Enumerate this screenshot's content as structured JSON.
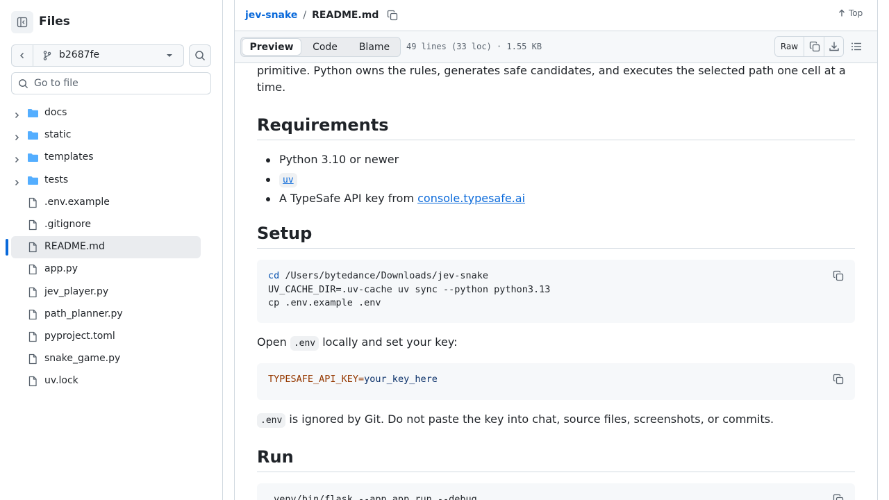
{
  "sidebar": {
    "title": "Files",
    "branch": "b2687fe",
    "goto_placeholder": "Go to file",
    "tree": [
      {
        "label": "docs",
        "type": "folder"
      },
      {
        "label": "static",
        "type": "folder"
      },
      {
        "label": "templates",
        "type": "folder"
      },
      {
        "label": "tests",
        "type": "folder"
      },
      {
        "label": ".env.example",
        "type": "file"
      },
      {
        "label": ".gitignore",
        "type": "file"
      },
      {
        "label": "README.md",
        "type": "file",
        "selected": true
      },
      {
        "label": "app.py",
        "type": "file"
      },
      {
        "label": "jev_player.py",
        "type": "file"
      },
      {
        "label": "path_planner.py",
        "type": "file"
      },
      {
        "label": "pyproject.toml",
        "type": "file"
      },
      {
        "label": "snake_game.py",
        "type": "file"
      },
      {
        "label": "uv.lock",
        "type": "file"
      }
    ]
  },
  "header": {
    "repo": "jev-snake",
    "separator": "/",
    "file": "README.md",
    "top_label": "Top"
  },
  "file_bar": {
    "tabs": [
      "Preview",
      "Code",
      "Blame"
    ],
    "active_tab": "Preview",
    "meta": "49 lines (33 loc) · 1.55 KB",
    "raw_label": "Raw"
  },
  "readme": {
    "intro": "primitive. Python owns the rules, generates safe candidates, and executes the selected path one cell at a time.",
    "requirements_heading": "Requirements",
    "req_python": "Python 3.10 or newer",
    "req_uv": "uv",
    "req_api_prefix": "A TypeSafe API key from ",
    "req_api_link": "console.typesafe.ai",
    "setup_heading": "Setup",
    "setup_code": {
      "line1_cmd": "cd",
      "line1_arg": " /Users/bytedance/Downloads/jev-snake",
      "line2": "UV_CACHE_DIR=.uv-cache uv sync --python python3.13",
      "line3": "cp .env.example .env"
    },
    "open_prefix": "Open ",
    "open_code": ".env",
    "open_suffix": " locally and set your key:",
    "env_code": {
      "var": "TYPESAFE_API_KEY=",
      "value": "your_key_here"
    },
    "ignored_code": ".env",
    "ignored_text": " is ignored by Git. Do not paste the key into chat, source files, screenshots, or commits.",
    "run_heading": "Run",
    "run_code": ".venv/bin/flask --app app run --debug"
  }
}
